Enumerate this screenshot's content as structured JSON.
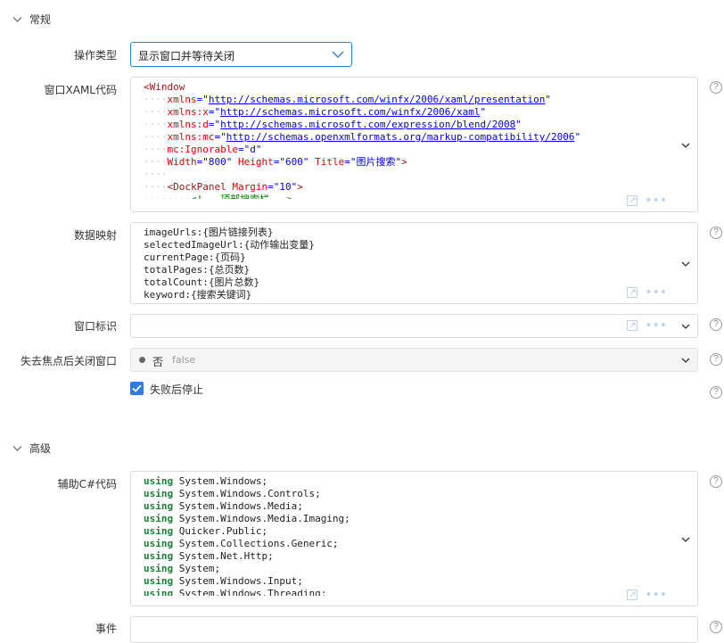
{
  "sections": {
    "general": "常规",
    "advanced": "高级"
  },
  "fields": {
    "action_type": {
      "label": "操作类型",
      "value": "显示窗口并等待关闭"
    },
    "xaml": {
      "label": "窗口XAML代码",
      "lines": [
        {
          "indent": "",
          "parts": [
            {
              "t": "<Window",
              "c": "tag"
            }
          ]
        },
        {
          "indent": "····",
          "parts": [
            {
              "t": "xmlns",
              "c": "attr"
            },
            {
              "t": "=\"",
              "c": "str"
            },
            {
              "t": "http://schemas.microsoft.com/winfx/2006/xaml/presentation",
              "c": "link"
            },
            {
              "t": "\"",
              "c": "str"
            }
          ]
        },
        {
          "indent": "····",
          "parts": [
            {
              "t": "xmlns:x",
              "c": "attr"
            },
            {
              "t": "=\"",
              "c": "str"
            },
            {
              "t": "http://schemas.microsoft.com/winfx/2006/xaml",
              "c": "link"
            },
            {
              "t": "\"",
              "c": "str"
            }
          ]
        },
        {
          "indent": "····",
          "parts": [
            {
              "t": "xmlns:d",
              "c": "attr"
            },
            {
              "t": "=\"",
              "c": "str"
            },
            {
              "t": "http://schemas.microsoft.com/expression/blend/2008",
              "c": "link"
            },
            {
              "t": "\"",
              "c": "str"
            }
          ]
        },
        {
          "indent": "····",
          "parts": [
            {
              "t": "xmlns:mc",
              "c": "attr"
            },
            {
              "t": "=\"",
              "c": "str"
            },
            {
              "t": "http://schemas.openxmlformats.org/markup-compatibility/2006",
              "c": "link"
            },
            {
              "t": "\"",
              "c": "str"
            }
          ]
        },
        {
          "indent": "····",
          "parts": [
            {
              "t": "mc:Ignorable",
              "c": "attr"
            },
            {
              "t": "=\"d\"",
              "c": "str"
            }
          ]
        },
        {
          "indent": "····",
          "parts": [
            {
              "t": "Width",
              "c": "attr"
            },
            {
              "t": "=\"800\" ",
              "c": "str"
            },
            {
              "t": "Height",
              "c": "attr"
            },
            {
              "t": "=\"600\" ",
              "c": "str"
            },
            {
              "t": "Title",
              "c": "attr"
            },
            {
              "t": "=\"图片搜索\"",
              "c": "str"
            },
            {
              "t": ">",
              "c": "tag"
            }
          ]
        },
        {
          "indent": "····",
          "parts": []
        },
        {
          "indent": "····",
          "parts": [
            {
              "t": "<DockPanel ",
              "c": "tag"
            },
            {
              "t": "Margin",
              "c": "attr"
            },
            {
              "t": "=\"10\"",
              "c": "str"
            },
            {
              "t": ">",
              "c": "tag"
            }
          ]
        },
        {
          "indent": "········",
          "parts": [
            {
              "t": "<!-- 顶部搜索栏 -->",
              "c": "cmt"
            }
          ]
        }
      ]
    },
    "data_mapping": {
      "label": "数据映射",
      "lines": [
        "imageUrls:{图片链接列表}",
        "selectedImageUrl:{动作输出变量}",
        "currentPage:{页码}",
        "totalPages:{总页数}",
        "totalCount:{图片总数}",
        "keyword:{搜索关键词}"
      ]
    },
    "window_id": {
      "label": "窗口标识",
      "value": ""
    },
    "close_on_blur": {
      "label": "失去焦点后关闭窗口",
      "value_text": "否",
      "value_hint": "false"
    },
    "stop_on_fail": {
      "label": "失败后停止",
      "checked": true
    },
    "csharp": {
      "label": "辅助C#代码",
      "keyword": "using",
      "lines": [
        "System.Windows;",
        "System.Windows.Controls;",
        "System.Windows.Media;",
        "System.Windows.Media.Imaging;",
        "Quicker.Public;",
        "System.Collections.Generic;",
        "System.Net.Http;",
        "System;",
        "System.Windows.Input;",
        "System.Windows.Threading;"
      ]
    },
    "events": {
      "label": "事件"
    }
  },
  "icons": {
    "help": "?",
    "dots": "•••"
  },
  "colors": {
    "accent": "#2f7de1",
    "border": "#dcdcdc"
  }
}
